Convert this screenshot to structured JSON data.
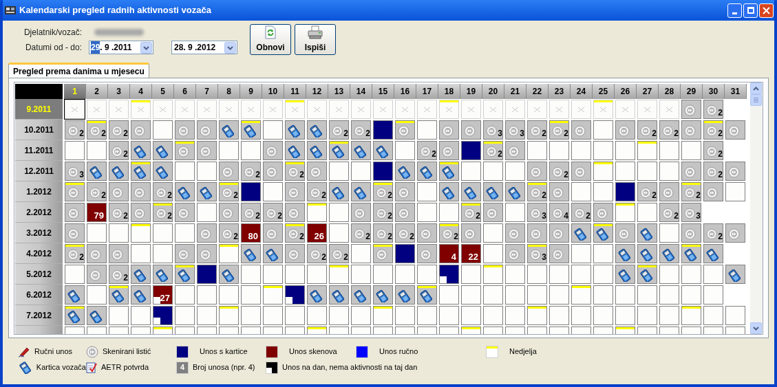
{
  "window": {
    "title": "Kalendarski pregled radnih aktivnosti vozača"
  },
  "form": {
    "employee_label": "Djelatnik/vozač:",
    "dates_label": "Datumi od - do:",
    "date_from": {
      "selection": "29",
      "value": ". 9 .2011"
    },
    "date_to": {
      "value": "28. 9 .2012"
    }
  },
  "buttons": [
    {
      "kind": "refresh",
      "label": "Obnovi"
    },
    {
      "kind": "print",
      "label": "Ispiši"
    }
  ],
  "tabs": [
    {
      "label": "Pregled prema danima u mjesecu",
      "selected": true
    }
  ],
  "days": [
    {
      "label": "1",
      "selected": true
    },
    {
      "label": "2",
      "selected": false
    },
    {
      "label": "3",
      "selected": false
    },
    {
      "label": "4",
      "selected": false
    },
    {
      "label": "5",
      "selected": false
    },
    {
      "label": "6",
      "selected": false
    },
    {
      "label": "7",
      "selected": false
    },
    {
      "label": "8",
      "selected": false
    },
    {
      "label": "9",
      "selected": false
    },
    {
      "label": "10",
      "selected": false
    },
    {
      "label": "11",
      "selected": false
    },
    {
      "label": "12",
      "selected": false
    },
    {
      "label": "13",
      "selected": false
    },
    {
      "label": "14",
      "selected": false
    },
    {
      "label": "15",
      "selected": false
    },
    {
      "label": "16",
      "selected": false
    },
    {
      "label": "17",
      "selected": false
    },
    {
      "label": "18",
      "selected": false
    },
    {
      "label": "19",
      "selected": false
    },
    {
      "label": "20",
      "selected": false
    },
    {
      "label": "21",
      "selected": false
    },
    {
      "label": "22",
      "selected": false
    },
    {
      "label": "23",
      "selected": false
    },
    {
      "label": "24",
      "selected": false
    },
    {
      "label": "25",
      "selected": false
    },
    {
      "label": "26",
      "selected": false
    },
    {
      "label": "27",
      "selected": false
    },
    {
      "label": "28",
      "selected": false
    },
    {
      "label": "29",
      "selected": false
    },
    {
      "label": "30",
      "selected": false
    },
    {
      "label": "31",
      "selected": false
    }
  ],
  "rows": [
    {
      "month": "9.2011",
      "selected": true,
      "cells": [
        {
          "kind": "outside",
          "sunday": false
        },
        {
          "kind": "outside",
          "sunday": false
        },
        {
          "kind": "outside",
          "sunday": false
        },
        {
          "kind": "outside",
          "sunday": true
        },
        {
          "kind": "outside",
          "sunday": false
        },
        {
          "kind": "outside",
          "sunday": false
        },
        {
          "kind": "outside",
          "sunday": false
        },
        {
          "kind": "outside",
          "sunday": false
        },
        {
          "kind": "outside",
          "sunday": false
        },
        {
          "kind": "outside",
          "sunday": false
        },
        {
          "kind": "outside",
          "sunday": true
        },
        {
          "kind": "outside",
          "sunday": false
        },
        {
          "kind": "outside",
          "sunday": false
        },
        {
          "kind": "outside",
          "sunday": false
        },
        {
          "kind": "outside",
          "sunday": false
        },
        {
          "kind": "outside",
          "sunday": false
        },
        {
          "kind": "outside",
          "sunday": false
        },
        {
          "kind": "outside",
          "sunday": true
        },
        {
          "kind": "outside",
          "sunday": false
        },
        {
          "kind": "outside",
          "sunday": false
        },
        {
          "kind": "outside",
          "sunday": false
        },
        {
          "kind": "outside",
          "sunday": false
        },
        {
          "kind": "outside",
          "sunday": false
        },
        {
          "kind": "outside",
          "sunday": false
        },
        {
          "kind": "outside",
          "sunday": true
        },
        {
          "kind": "outside",
          "sunday": false
        },
        {
          "kind": "outside",
          "sunday": false
        },
        {
          "kind": "outside",
          "sunday": false
        },
        {
          "kind": "scan",
          "sunday": false
        },
        {
          "kind": "scan",
          "count": "2",
          "sunday": false
        }
      ]
    },
    {
      "month": "10.2011",
      "selected": false,
      "cells": [
        {
          "kind": "scan",
          "count": "2",
          "sunday": false
        },
        {
          "kind": "scan",
          "count": "2",
          "sunday": true
        },
        {
          "kind": "scan",
          "count": "2",
          "sunday": false
        },
        {
          "kind": "scan",
          "sunday": false
        },
        {
          "kind": "empty",
          "sunday": false
        },
        {
          "kind": "scan",
          "sunday": false
        },
        {
          "kind": "scan",
          "sunday": false
        },
        {
          "kind": "card",
          "sunday": false
        },
        {
          "kind": "card",
          "sunday": true
        },
        {
          "kind": "empty",
          "sunday": false
        },
        {
          "kind": "card",
          "sunday": false
        },
        {
          "kind": "card",
          "sunday": false
        },
        {
          "kind": "scan",
          "count": "2",
          "sunday": false
        },
        {
          "kind": "scan",
          "count": "2",
          "sunday": false
        },
        {
          "kind": "card_entry",
          "sunday": false
        },
        {
          "kind": "scan",
          "sunday": true
        },
        {
          "kind": "empty",
          "sunday": false
        },
        {
          "kind": "scan",
          "sunday": false
        },
        {
          "kind": "scan",
          "sunday": false
        },
        {
          "kind": "scan",
          "count": "3",
          "sunday": false
        },
        {
          "kind": "scan",
          "count": "3",
          "sunday": false
        },
        {
          "kind": "scan",
          "count": "2",
          "sunday": false
        },
        {
          "kind": "scan",
          "count": "2",
          "sunday": true
        },
        {
          "kind": "scan",
          "sunday": false
        },
        {
          "kind": "empty",
          "sunday": false
        },
        {
          "kind": "scan",
          "sunday": false
        },
        {
          "kind": "scan",
          "count": "2",
          "sunday": false
        },
        {
          "kind": "scan",
          "count": "2",
          "sunday": false
        },
        {
          "kind": "scan",
          "sunday": false
        },
        {
          "kind": "scan",
          "count": "2",
          "sunday": true
        },
        {
          "kind": "scan",
          "sunday": false
        }
      ]
    },
    {
      "month": "11.2011",
      "selected": false,
      "cells": [
        {
          "kind": "empty",
          "sunday": false
        },
        {
          "kind": "empty",
          "sunday": false
        },
        {
          "kind": "scan",
          "count": "2",
          "sunday": false
        },
        {
          "kind": "card",
          "sunday": false
        },
        {
          "kind": "card",
          "sunday": false
        },
        {
          "kind": "scan",
          "sunday": true
        },
        {
          "kind": "scan",
          "sunday": false
        },
        {
          "kind": "empty",
          "sunday": false
        },
        {
          "kind": "empty",
          "sunday": false
        },
        {
          "kind": "scan",
          "sunday": false
        },
        {
          "kind": "card",
          "sunday": false
        },
        {
          "kind": "card",
          "sunday": false
        },
        {
          "kind": "card",
          "sunday": true
        },
        {
          "kind": "card",
          "sunday": false
        },
        {
          "kind": "card",
          "sunday": false
        },
        {
          "kind": "empty",
          "sunday": false
        },
        {
          "kind": "scan",
          "count": "2",
          "sunday": false
        },
        {
          "kind": "scan",
          "sunday": false
        },
        {
          "kind": "card_entry",
          "sunday": false
        },
        {
          "kind": "scan",
          "count": "2",
          "sunday": true
        },
        {
          "kind": "scan",
          "sunday": false
        },
        {
          "kind": "empty",
          "sunday": false
        },
        {
          "kind": "empty",
          "sunday": false
        },
        {
          "kind": "empty",
          "sunday": false
        },
        {
          "kind": "empty",
          "sunday": false
        },
        {
          "kind": "empty",
          "sunday": false
        },
        {
          "kind": "empty",
          "sunday": true
        },
        {
          "kind": "empty",
          "sunday": false
        },
        {
          "kind": "empty",
          "sunday": false
        },
        {
          "kind": "scan",
          "count": "2",
          "sunday": false
        }
      ]
    },
    {
      "month": "12.2011",
      "selected": false,
      "cells": [
        {
          "kind": "scan",
          "count": "3",
          "sunday": false
        },
        {
          "kind": "card",
          "sunday": false
        },
        {
          "kind": "card",
          "sunday": false
        },
        {
          "kind": "card",
          "sunday": true
        },
        {
          "kind": "card",
          "sunday": false
        },
        {
          "kind": "empty",
          "sunday": false
        },
        {
          "kind": "empty",
          "sunday": false
        },
        {
          "kind": "scan",
          "sunday": false
        },
        {
          "kind": "scan",
          "count": "2",
          "sunday": false
        },
        {
          "kind": "scan",
          "sunday": false
        },
        {
          "kind": "scan",
          "count": "2",
          "sunday": true
        },
        {
          "kind": "scan",
          "sunday": false
        },
        {
          "kind": "empty",
          "sunday": false
        },
        {
          "kind": "empty",
          "sunday": false
        },
        {
          "kind": "card_entry",
          "sunday": false
        },
        {
          "kind": "card",
          "sunday": false
        },
        {
          "kind": "card",
          "sunday": false
        },
        {
          "kind": "card",
          "sunday": true
        },
        {
          "kind": "empty",
          "sunday": false
        },
        {
          "kind": "empty",
          "sunday": false
        },
        {
          "kind": "empty",
          "sunday": false
        },
        {
          "kind": "scan",
          "sunday": false
        },
        {
          "kind": "scan",
          "count": "2",
          "sunday": false
        },
        {
          "kind": "scan",
          "sunday": false
        },
        {
          "kind": "empty",
          "sunday": true
        },
        {
          "kind": "empty",
          "sunday": false
        },
        {
          "kind": "empty",
          "sunday": false
        },
        {
          "kind": "empty",
          "sunday": false
        },
        {
          "kind": "scan",
          "sunday": false
        },
        {
          "kind": "scan",
          "count": "2",
          "sunday": false
        },
        {
          "kind": "scan",
          "sunday": false
        }
      ]
    },
    {
      "month": "1.2012",
      "selected": false,
      "cells": [
        {
          "kind": "scan",
          "sunday": true
        },
        {
          "kind": "scan",
          "count": "2",
          "sunday": false
        },
        {
          "kind": "scan",
          "sunday": false
        },
        {
          "kind": "scan",
          "sunday": false
        },
        {
          "kind": "scan",
          "count": "2",
          "sunday": false
        },
        {
          "kind": "card",
          "sunday": false
        },
        {
          "kind": "card",
          "sunday": false
        },
        {
          "kind": "scan",
          "count": "2",
          "sunday": true
        },
        {
          "kind": "card_entry",
          "sunday": false
        },
        {
          "kind": "empty",
          "sunday": false
        },
        {
          "kind": "scan",
          "sunday": false
        },
        {
          "kind": "scan",
          "count": "2",
          "sunday": false
        },
        {
          "kind": "card",
          "sunday": false
        },
        {
          "kind": "card",
          "sunday": false
        },
        {
          "kind": "scan",
          "count": "2",
          "sunday": true
        },
        {
          "kind": "scan",
          "sunday": false
        },
        {
          "kind": "empty",
          "sunday": false
        },
        {
          "kind": "card",
          "sunday": false
        },
        {
          "kind": "card",
          "sunday": false
        },
        {
          "kind": "card",
          "sunday": false
        },
        {
          "kind": "card",
          "sunday": false
        },
        {
          "kind": "scan",
          "count": "2",
          "sunday": true
        },
        {
          "kind": "scan",
          "sunday": false
        },
        {
          "kind": "empty",
          "sunday": false
        },
        {
          "kind": "empty",
          "sunday": false
        },
        {
          "kind": "card_entry",
          "sunday": false
        },
        {
          "kind": "scan",
          "count": "2",
          "sunday": false
        },
        {
          "kind": "scan",
          "sunday": false
        },
        {
          "kind": "scan",
          "count": "2",
          "sunday": true
        },
        {
          "kind": "scan",
          "sunday": false
        },
        {
          "kind": "empty",
          "sunday": false
        }
      ]
    },
    {
      "month": "2.2012",
      "selected": false,
      "cells": [
        {
          "kind": "scan",
          "sunday": false
        },
        {
          "kind": "scan_entry",
          "count": "79",
          "sunday": false
        },
        {
          "kind": "scan",
          "count": "2",
          "sunday": false
        },
        {
          "kind": "scan",
          "sunday": false
        },
        {
          "kind": "scan",
          "count": "2",
          "sunday": true
        },
        {
          "kind": "scan",
          "sunday": false
        },
        {
          "kind": "empty",
          "sunday": false
        },
        {
          "kind": "scan",
          "sunday": false
        },
        {
          "kind": "scan",
          "count": "2",
          "sunday": false
        },
        {
          "kind": "scan",
          "count": "2",
          "sunday": false
        },
        {
          "kind": "scan",
          "sunday": false
        },
        {
          "kind": "empty",
          "sunday": true
        },
        {
          "kind": "empty",
          "sunday": false
        },
        {
          "kind": "scan",
          "sunday": false
        },
        {
          "kind": "scan",
          "count": "2",
          "sunday": false
        },
        {
          "kind": "scan",
          "sunday": false
        },
        {
          "kind": "empty",
          "sunday": false
        },
        {
          "kind": "empty",
          "sunday": false
        },
        {
          "kind": "scan",
          "count": "2",
          "sunday": true
        },
        {
          "kind": "scan",
          "sunday": false
        },
        {
          "kind": "empty",
          "sunday": false
        },
        {
          "kind": "scan",
          "count": "3",
          "sunday": false
        },
        {
          "kind": "scan",
          "count": "4",
          "sunday": false
        },
        {
          "kind": "scan",
          "count": "2",
          "sunday": false
        },
        {
          "kind": "scan",
          "sunday": false
        },
        {
          "kind": "empty",
          "sunday": true
        },
        {
          "kind": "empty",
          "sunday": false
        },
        {
          "kind": "scan",
          "count": "2",
          "sunday": false
        },
        {
          "kind": "scan",
          "count": "3",
          "sunday": false
        }
      ]
    },
    {
      "month": "3.2012",
      "selected": false,
      "cells": [
        {
          "kind": "scan",
          "sunday": false
        },
        {
          "kind": "empty",
          "sunday": false
        },
        {
          "kind": "empty",
          "sunday": false
        },
        {
          "kind": "empty",
          "sunday": true
        },
        {
          "kind": "empty",
          "sunday": false
        },
        {
          "kind": "empty",
          "sunday": false
        },
        {
          "kind": "scan",
          "sunday": false
        },
        {
          "kind": "scan",
          "count": "2",
          "sunday": false
        },
        {
          "kind": "scan_entry",
          "count": "80",
          "sunday": false
        },
        {
          "kind": "scan",
          "sunday": false
        },
        {
          "kind": "scan",
          "count": "2",
          "sunday": true
        },
        {
          "kind": "scan_entry",
          "count": "26",
          "sunday": false
        },
        {
          "kind": "empty",
          "sunday": false
        },
        {
          "kind": "scan",
          "count": "2",
          "sunday": false
        },
        {
          "kind": "scan",
          "count": "2",
          "sunday": false
        },
        {
          "kind": "scan",
          "count": "2",
          "sunday": false
        },
        {
          "kind": "scan",
          "sunday": false
        },
        {
          "kind": "scan",
          "count": "2",
          "sunday": true
        },
        {
          "kind": "scan",
          "sunday": false
        },
        {
          "kind": "empty",
          "sunday": false
        },
        {
          "kind": "scan",
          "sunday": false
        },
        {
          "kind": "scan",
          "sunday": false
        },
        {
          "kind": "scan",
          "sunday": false
        },
        {
          "kind": "card",
          "sunday": false
        },
        {
          "kind": "card",
          "sunday": true
        },
        {
          "kind": "scan",
          "sunday": false
        },
        {
          "kind": "card",
          "sunday": false
        },
        {
          "kind": "empty",
          "sunday": false
        },
        {
          "kind": "scan",
          "sunday": false
        },
        {
          "kind": "scan",
          "count": "2",
          "sunday": false
        },
        {
          "kind": "scan",
          "sunday": false
        }
      ]
    },
    {
      "month": "4.2012",
      "selected": false,
      "cells": [
        {
          "kind": "scan",
          "count": "2",
          "sunday": true
        },
        {
          "kind": "scan",
          "sunday": false
        },
        {
          "kind": "scan",
          "sunday": false
        },
        {
          "kind": "empty",
          "sunday": false
        },
        {
          "kind": "empty",
          "sunday": false
        },
        {
          "kind": "scan",
          "sunday": false
        },
        {
          "kind": "scan",
          "sunday": false
        },
        {
          "kind": "empty",
          "sunday": true
        },
        {
          "kind": "card",
          "sunday": false
        },
        {
          "kind": "card",
          "sunday": false
        },
        {
          "kind": "scan",
          "sunday": false
        },
        {
          "kind": "scan",
          "count": "2",
          "sunday": false
        },
        {
          "kind": "scan",
          "count": "2",
          "sunday": false
        },
        {
          "kind": "empty",
          "sunday": false
        },
        {
          "kind": "scan",
          "sunday": true
        },
        {
          "kind": "card_entry",
          "sunday": false
        },
        {
          "kind": "scan",
          "sunday": false
        },
        {
          "kind": "scan_entry",
          "count": "4",
          "sunday": false
        },
        {
          "kind": "scan_entry",
          "count": "22",
          "sunday": false
        },
        {
          "kind": "empty",
          "sunday": false
        },
        {
          "kind": "scan",
          "sunday": false
        },
        {
          "kind": "scan",
          "count": "3",
          "sunday": true
        },
        {
          "kind": "scan",
          "sunday": false
        },
        {
          "kind": "empty",
          "sunday": false
        },
        {
          "kind": "empty",
          "sunday": false
        },
        {
          "kind": "card",
          "sunday": false
        },
        {
          "kind": "card",
          "sunday": false
        },
        {
          "kind": "card",
          "sunday": false
        },
        {
          "kind": "card",
          "sunday": true
        },
        {
          "kind": "card",
          "sunday": false
        }
      ]
    },
    {
      "month": "5.2012",
      "selected": false,
      "cells": [
        {
          "kind": "empty",
          "sunday": false
        },
        {
          "kind": "scan",
          "sunday": false
        },
        {
          "kind": "scan",
          "count": "2",
          "sunday": false
        },
        {
          "kind": "card",
          "sunday": false
        },
        {
          "kind": "card",
          "sunday": false
        },
        {
          "kind": "card",
          "sunday": true
        },
        {
          "kind": "card_entry",
          "sunday": false
        },
        {
          "kind": "card",
          "sunday": false
        },
        {
          "kind": "empty",
          "sunday": false
        },
        {
          "kind": "empty",
          "sunday": false
        },
        {
          "kind": "empty",
          "sunday": false
        },
        {
          "kind": "empty",
          "sunday": false
        },
        {
          "kind": "empty",
          "sunday": true
        },
        {
          "kind": "empty",
          "sunday": false
        },
        {
          "kind": "empty",
          "sunday": false
        },
        {
          "kind": "empty",
          "sunday": false
        },
        {
          "kind": "empty",
          "sunday": false
        },
        {
          "kind": "card_entry_partial",
          "sunday": false
        },
        {
          "kind": "empty",
          "sunday": false
        },
        {
          "kind": "empty",
          "sunday": true
        },
        {
          "kind": "empty",
          "sunday": false
        },
        {
          "kind": "empty",
          "sunday": false
        },
        {
          "kind": "empty",
          "sunday": false
        },
        {
          "kind": "empty",
          "sunday": false
        },
        {
          "kind": "empty",
          "sunday": false
        },
        {
          "kind": "card",
          "sunday": false
        },
        {
          "kind": "card",
          "sunday": true
        },
        {
          "kind": "empty",
          "sunday": false
        },
        {
          "kind": "empty",
          "sunday": false
        },
        {
          "kind": "empty",
          "sunday": false
        },
        {
          "kind": "card",
          "sunday": false
        }
      ]
    },
    {
      "month": "6.2012",
      "selected": false,
      "cells": [
        {
          "kind": "card",
          "sunday": false
        },
        {
          "kind": "empty",
          "sunday": false
        },
        {
          "kind": "card",
          "sunday": true
        },
        {
          "kind": "card",
          "sunday": false
        },
        {
          "kind": "scan_entry_partial",
          "count": "27",
          "sunday": false
        },
        {
          "kind": "empty",
          "sunday": false
        },
        {
          "kind": "empty",
          "sunday": false
        },
        {
          "kind": "empty",
          "sunday": false
        },
        {
          "kind": "empty",
          "sunday": false
        },
        {
          "kind": "empty",
          "sunday": true
        },
        {
          "kind": "card_entry_partial",
          "sunday": false
        },
        {
          "kind": "card",
          "sunday": false
        },
        {
          "kind": "card",
          "sunday": false
        },
        {
          "kind": "card",
          "sunday": false
        },
        {
          "kind": "card",
          "sunday": false
        },
        {
          "kind": "card",
          "sunday": false
        },
        {
          "kind": "card",
          "sunday": true
        },
        {
          "kind": "empty",
          "sunday": false
        },
        {
          "kind": "empty",
          "sunday": false
        },
        {
          "kind": "empty",
          "sunday": false
        },
        {
          "kind": "empty",
          "sunday": false
        },
        {
          "kind": "empty",
          "sunday": false
        },
        {
          "kind": "empty",
          "sunday": false
        },
        {
          "kind": "empty",
          "sunday": true
        },
        {
          "kind": "empty",
          "sunday": false
        },
        {
          "kind": "empty",
          "sunday": false
        },
        {
          "kind": "empty",
          "sunday": false
        },
        {
          "kind": "empty",
          "sunday": false
        },
        {
          "kind": "empty",
          "sunday": false
        },
        {
          "kind": "empty",
          "sunday": false
        }
      ]
    },
    {
      "month": "7.2012",
      "selected": false,
      "cells": [
        {
          "kind": "card",
          "sunday": true
        },
        {
          "kind": "card",
          "sunday": false
        },
        {
          "kind": "empty",
          "sunday": false
        },
        {
          "kind": "empty",
          "sunday": false
        },
        {
          "kind": "card_entry_partial",
          "sunday": false
        },
        {
          "kind": "empty",
          "sunday": false
        },
        {
          "kind": "empty",
          "sunday": false
        },
        {
          "kind": "empty",
          "sunday": true
        },
        {
          "kind": "empty",
          "sunday": false
        },
        {
          "kind": "empty",
          "sunday": false
        },
        {
          "kind": "empty",
          "sunday": false
        },
        {
          "kind": "empty",
          "sunday": false
        },
        {
          "kind": "empty",
          "sunday": false
        },
        {
          "kind": "empty",
          "sunday": false
        },
        {
          "kind": "empty",
          "sunday": true
        },
        {
          "kind": "empty",
          "sunday": false
        },
        {
          "kind": "empty",
          "sunday": false
        },
        {
          "kind": "empty",
          "sunday": false
        },
        {
          "kind": "empty",
          "sunday": false
        },
        {
          "kind": "empty",
          "sunday": false
        },
        {
          "kind": "empty",
          "sunday": false
        },
        {
          "kind": "empty",
          "sunday": true
        },
        {
          "kind": "empty",
          "sunday": false
        },
        {
          "kind": "empty",
          "sunday": false
        },
        {
          "kind": "empty",
          "sunday": false
        },
        {
          "kind": "empty",
          "sunday": false
        },
        {
          "kind": "empty",
          "sunday": false
        },
        {
          "kind": "empty",
          "sunday": false
        },
        {
          "kind": "empty",
          "sunday": true
        },
        {
          "kind": "empty",
          "sunday": false
        },
        {
          "kind": "empty",
          "sunday": false
        }
      ]
    },
    {
      "selected": false,
      "cells": [
        {
          "kind": "empty",
          "sunday": false
        },
        {
          "kind": "empty",
          "sunday": false
        },
        {
          "kind": "empty",
          "sunday": false
        },
        {
          "kind": "empty",
          "sunday": false
        },
        {
          "kind": "empty",
          "sunday": true
        },
        {
          "kind": "empty",
          "sunday": false
        },
        {
          "kind": "empty",
          "sunday": false
        },
        {
          "kind": "empty",
          "sunday": false
        },
        {
          "kind": "empty",
          "sunday": false
        },
        {
          "kind": "empty",
          "sunday": false
        },
        {
          "kind": "empty",
          "sunday": false
        },
        {
          "kind": "empty",
          "sunday": true
        },
        {
          "kind": "empty",
          "sunday": false
        },
        {
          "kind": "empty",
          "sunday": false
        },
        {
          "kind": "empty",
          "sunday": false
        },
        {
          "kind": "empty",
          "sunday": false
        },
        {
          "kind": "empty",
          "sunday": false
        },
        {
          "kind": "empty",
          "sunday": false
        },
        {
          "kind": "empty",
          "sunday": true
        },
        {
          "kind": "empty",
          "sunday": false
        },
        {
          "kind": "empty",
          "sunday": false
        },
        {
          "kind": "empty",
          "sunday": false
        },
        {
          "kind": "empty",
          "sunday": false
        },
        {
          "kind": "empty",
          "sunday": false
        },
        {
          "kind": "empty",
          "sunday": false
        },
        {
          "kind": "empty",
          "sunday": true
        },
        {
          "kind": "empty",
          "sunday": false
        },
        {
          "kind": "empty",
          "sunday": false
        },
        {
          "kind": "empty",
          "sunday": false
        },
        {
          "kind": "empty",
          "sunday": false
        },
        {
          "kind": "empty",
          "sunday": false
        }
      ]
    }
  ],
  "legend": [
    [
      {
        "kind": "pencil",
        "label": "Ručni unos"
      },
      {
        "kind": "card",
        "label": "Kartica vozača"
      }
    ],
    [
      {
        "kind": "scan",
        "label": "Skenirani listić"
      },
      {
        "kind": "aetr",
        "label": "AETR potvrda"
      }
    ],
    [
      {
        "kind": "card_entry",
        "label": "Unos s kartice"
      },
      {
        "kind": "count",
        "swatch_text": "4",
        "label": "Broj unosa (npr. 4)"
      }
    ],
    [
      {
        "kind": "scan_entry",
        "label": "Unos skenova"
      },
      {
        "kind": "partial",
        "label": "Unos na dan, nema aktivnosti na taj dan"
      }
    ],
    [
      {
        "kind": "manual_entry",
        "label": "Unos ručno"
      }
    ],
    [
      {
        "kind": "sunday",
        "label": "Nedjelja"
      }
    ]
  ]
}
